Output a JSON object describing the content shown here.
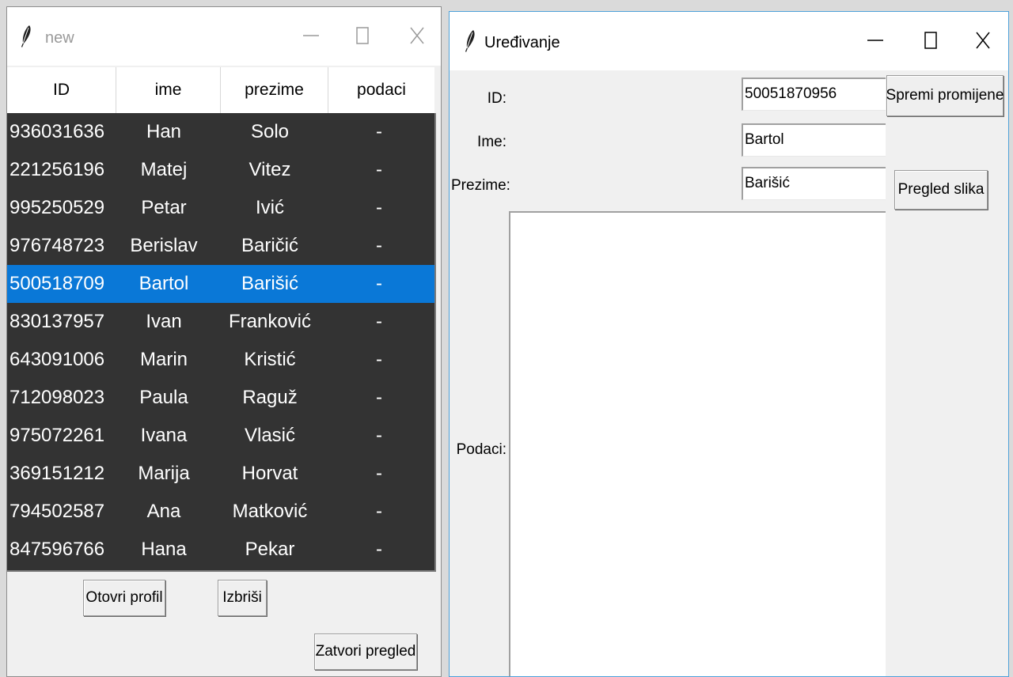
{
  "left_window": {
    "title": "new",
    "controls": {
      "minimize": "—",
      "maximize": "☐",
      "close": "X"
    },
    "columns": [
      "ID",
      "ime",
      "prezime",
      "podaci"
    ],
    "rows": [
      {
        "id": "936031636",
        "ime": "Han",
        "prezime": "Solo",
        "podaci": "-"
      },
      {
        "id": "221256196",
        "ime": "Matej",
        "prezime": "Vitez",
        "podaci": "-"
      },
      {
        "id": "995250529",
        "ime": "Petar",
        "prezime": "Ivić",
        "podaci": "-"
      },
      {
        "id": "976748723",
        "ime": "Berislav",
        "prezime": "Baričić",
        "podaci": "-"
      },
      {
        "id": "500518709",
        "ime": "Bartol",
        "prezime": "Barišić",
        "podaci": "-"
      },
      {
        "id": "830137957",
        "ime": "Ivan",
        "prezime": "Franković",
        "podaci": "-"
      },
      {
        "id": "643091006",
        "ime": "Marin",
        "prezime": "Kristić",
        "podaci": "-"
      },
      {
        "id": "712098023",
        "ime": "Paula",
        "prezime": "Raguž",
        "podaci": "-"
      },
      {
        "id": "975072261",
        "ime": "Ivana",
        "prezime": "Vlasić",
        "podaci": "-"
      },
      {
        "id": "369151212",
        "ime": "Marija",
        "prezime": "Horvat",
        "podaci": "-"
      },
      {
        "id": "794502587",
        "ime": "Ana",
        "prezime": "Matković",
        "podaci": "-"
      },
      {
        "id": "847596766",
        "ime": "Hana",
        "prezime": "Pekar",
        "podaci": "-"
      }
    ],
    "selected_row": 4,
    "buttons": {
      "open_profile": "Otovri profil",
      "delete": "Izbriši",
      "close_view": "Zatvori pregled"
    }
  },
  "right_window": {
    "title": "Uređivanje",
    "controls": {
      "minimize": "—",
      "maximize": "☐",
      "close": "X"
    },
    "labels": {
      "id": "ID:",
      "ime": "Ime:",
      "prezime": "Prezime:",
      "podaci": "Podaci:"
    },
    "fields": {
      "id": "50051870956",
      "ime": "Bartol",
      "prezime": "Barišić",
      "podaci": ""
    },
    "buttons": {
      "save": "Spremi promijene",
      "gallery": "Pregled slika"
    }
  },
  "colors": {
    "table_bg": "#333333",
    "selection": "#0a78d7",
    "window_bg": "#f0f0f0",
    "active_border": "#4ea1d9"
  }
}
